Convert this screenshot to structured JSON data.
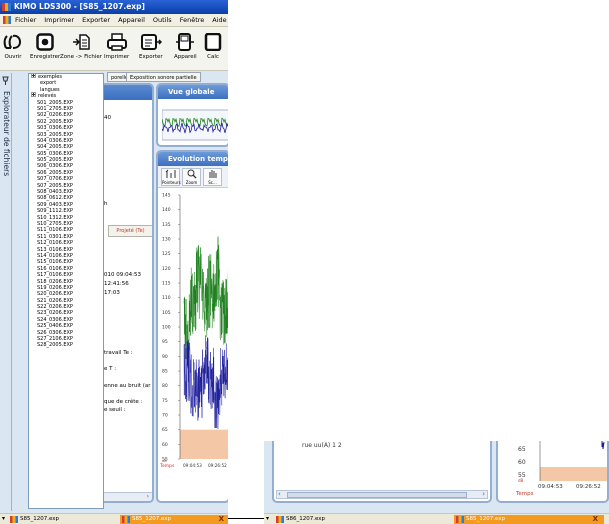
{
  "window": {
    "title": "KIMO LDS300 - [S85_1207.exp]"
  },
  "menubar": [
    "Fichier",
    "Imprimer",
    "Exporter",
    "Appareil",
    "Outils",
    "Fenêtre",
    "Aide"
  ],
  "toolbar": {
    "ouvrir": "Ouvrir",
    "enregistrer": "Enregistrer",
    "zone_fichier": "Zone -> Fichier",
    "imprimer": "Imprimer",
    "exporter": "Exporter",
    "appareil": "Appareil",
    "calc": "Calc"
  },
  "tabs": {
    "tab1": "porelle",
    "tab2": "Exposition sonore partielle"
  },
  "explorer": {
    "side_label": "Explorateur de fichiers",
    "folders_top": [
      "exemples",
      "export",
      "langues",
      "relevés"
    ],
    "files": [
      "S01_2005.EXP",
      "S01_2705.EXP",
      "S02_0206.EXP",
      "S02_2005.EXP",
      "S03_0306.EXP",
      "S03_2005.EXP",
      "S04_0306.EXP",
      "S04_2005.EXP",
      "S05_0306.EXP",
      "S05_2005.EXP",
      "S06_0306.EXP",
      "S06_2005.EXP",
      "S07_0706.EXP",
      "S07_2005.EXP",
      "S08_0403.EXP",
      "S08_0612.EXP",
      "S09_0403.EXP",
      "S09_1112.EXP",
      "S10_1312.EXP",
      "S10_2705.EXP",
      "S11_0106.EXP",
      "S11_0301.EXP",
      "S12_0106.EXP",
      "S13_0106.EXP",
      "S14_0106.EXP",
      "S15_0106.EXP",
      "S16_0106.EXP",
      "S17_0106.EXP",
      "S18_0206.EXP",
      "S19_0206.EXP",
      "S20_0206.EXP",
      "S21_0206.EXP",
      "S22_0206.EXP",
      "S23_0206.EXP",
      "S24_0306.EXP",
      "S25_0406.EXP",
      "S26_0306.EXP",
      "S27_2106.EXP",
      "S28_2005.EXP"
    ]
  },
  "left_panel": {
    "value_40": "40",
    "value_h": "h",
    "tab_projete": "Projeté (Te)",
    "date1": "010 09:04:53",
    "time2": "12:41:56",
    "time3": "17:03",
    "travail": "travail Te :",
    "e_t": "e T :",
    "enne": "enne au bruit (ar",
    "crete": "que de crête :",
    "seuil": "e seuil :"
  },
  "vue_globale": {
    "title": "Vue globale"
  },
  "evolution": {
    "title": "Evolution temp",
    "btn_pointeurs": "Pointeurs",
    "btn_zoom": "Zoom",
    "btn_other": "Sc..."
  },
  "chart_data": {
    "type": "line",
    "title": "",
    "xlabel": "Temps",
    "ylabel": "dB",
    "ylim": [
      55,
      145
    ],
    "yticks": [
      145,
      140,
      135,
      130,
      125,
      120,
      115,
      110,
      105,
      100,
      95,
      90,
      85,
      80,
      75,
      70,
      65,
      60,
      55
    ],
    "xticks": [
      "09:04:53",
      "09:26:52"
    ],
    "series": [
      {
        "name": "",
        "color": "#1a7f1a",
        "values": [
          100,
          110,
          115,
          108,
          112,
          118,
          105,
          110
        ]
      },
      {
        "name": "",
        "color": "#1c1c9c",
        "values": [
          85,
          80,
          78,
          88,
          82,
          75,
          84,
          86
        ]
      }
    ],
    "threshold_band": {
      "from": 55,
      "to": 65,
      "color": "#f4c7a6"
    }
  },
  "lower_window": {
    "left_text": "rue uu(A)  1 2",
    "yticks": [
      "65",
      "60",
      "55"
    ],
    "unit": "dB",
    "xticks": [
      "09:04:53",
      "09:26:52"
    ],
    "xlabel": "Temps"
  },
  "taskbar": {
    "item1": "S85_1207.exp",
    "item2": "S85_1207.exp",
    "close": "X",
    "w2_item1": "S86_1207.exp",
    "w2_item2": "S85_1207.exp",
    "w2_close": "X"
  },
  "colors": {
    "titlebar": "#0a3fa8",
    "panel_header": "#3d6fc0",
    "accent_orange": "#f29a22",
    "green_series": "#1a7f1a",
    "blue_series": "#1c1c9c"
  }
}
